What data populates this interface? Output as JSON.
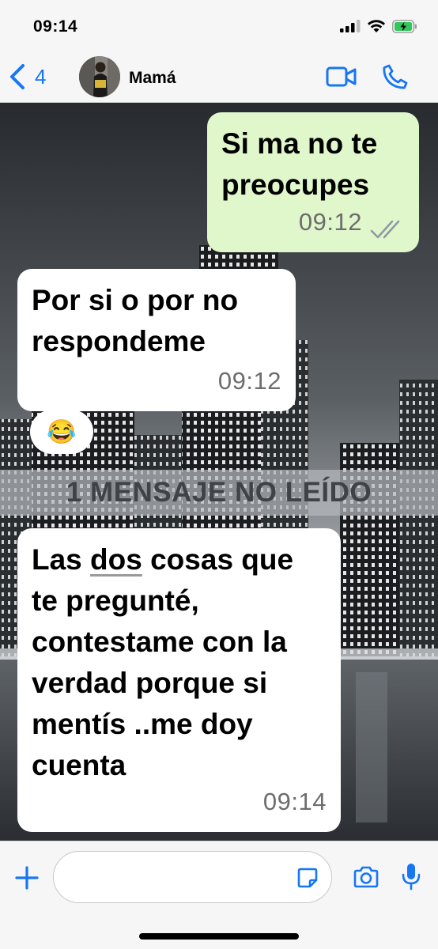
{
  "status_bar": {
    "time": "09:14"
  },
  "header": {
    "back_count": "4",
    "contact_name": "Mamá"
  },
  "messages": [
    {
      "direction": "outgoing",
      "text": "Si ma no te preocupes",
      "time": "09:12",
      "status": "read"
    },
    {
      "direction": "incoming",
      "text": "Por si o por no respondeme",
      "time": "09:12",
      "reaction": "😂"
    },
    {
      "direction": "incoming",
      "text": "Las dos cosas que te pregunté, contestame con la verdad porque si mentís ..me doy cuenta",
      "time": "09:14"
    }
  ],
  "reaction_emoji": "😂",
  "unread_divider": "1 MENSAJE NO LEÍDO",
  "input": {
    "value": ""
  },
  "colors": {
    "accent": "#1676f3",
    "outgoing_bubble": "#e0f7cc",
    "incoming_bubble": "#ffffff",
    "read_ticks": "#8f9aa3"
  },
  "icons": [
    "back-chevron-icon",
    "video-call-icon",
    "phone-icon",
    "plus-icon",
    "sticker-icon",
    "camera-icon",
    "microphone-icon",
    "signal-icon",
    "wifi-icon",
    "battery-icon"
  ]
}
